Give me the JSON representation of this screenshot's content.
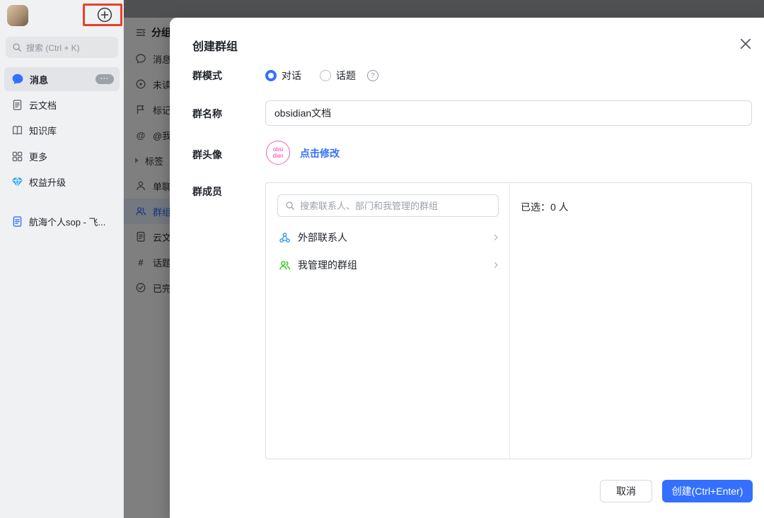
{
  "sidebar": {
    "search_placeholder": "搜索 (Ctrl + K)",
    "items": [
      {
        "label": "消息",
        "badge": "···"
      },
      {
        "label": "云文档"
      },
      {
        "label": "知识库"
      },
      {
        "label": "更多"
      },
      {
        "label": "权益升级"
      }
    ],
    "pinned_doc": "航海个人sop - 飞..."
  },
  "chat_list": {
    "header": "分组",
    "items": [
      {
        "label": "消息"
      },
      {
        "label": "未读"
      },
      {
        "label": "标记"
      },
      {
        "label": "@我"
      },
      {
        "label": "标签"
      },
      {
        "label": "单聊"
      },
      {
        "label": "群组",
        "selected": true
      },
      {
        "label": "云文档"
      },
      {
        "label": "话题"
      },
      {
        "label": "已完成"
      }
    ]
  },
  "modal": {
    "title": "创建群组",
    "mode": {
      "label": "群模式",
      "options": [
        {
          "label": "对话",
          "selected": true
        },
        {
          "label": "话题",
          "selected": false
        }
      ]
    },
    "name": {
      "label": "群名称",
      "value": "obsidian文档"
    },
    "avatar": {
      "label": "群头像",
      "avatar_line1": "obsi",
      "avatar_line2": "dian",
      "action": "点击修改"
    },
    "members": {
      "label": "群成员",
      "search_placeholder": "搜索联系人、部门和我管理的群组",
      "sources": [
        {
          "label": "外部联系人"
        },
        {
          "label": "我管理的群组"
        }
      ],
      "selected_summary": "已选：0 人"
    },
    "footer": {
      "cancel": "取消",
      "create": "创建(Ctrl+Enter)"
    }
  },
  "colors": {
    "accent": "#3370ff",
    "green": "#34c724",
    "magenta": "#ec3fa6",
    "annotation_red": "#e8402a"
  }
}
